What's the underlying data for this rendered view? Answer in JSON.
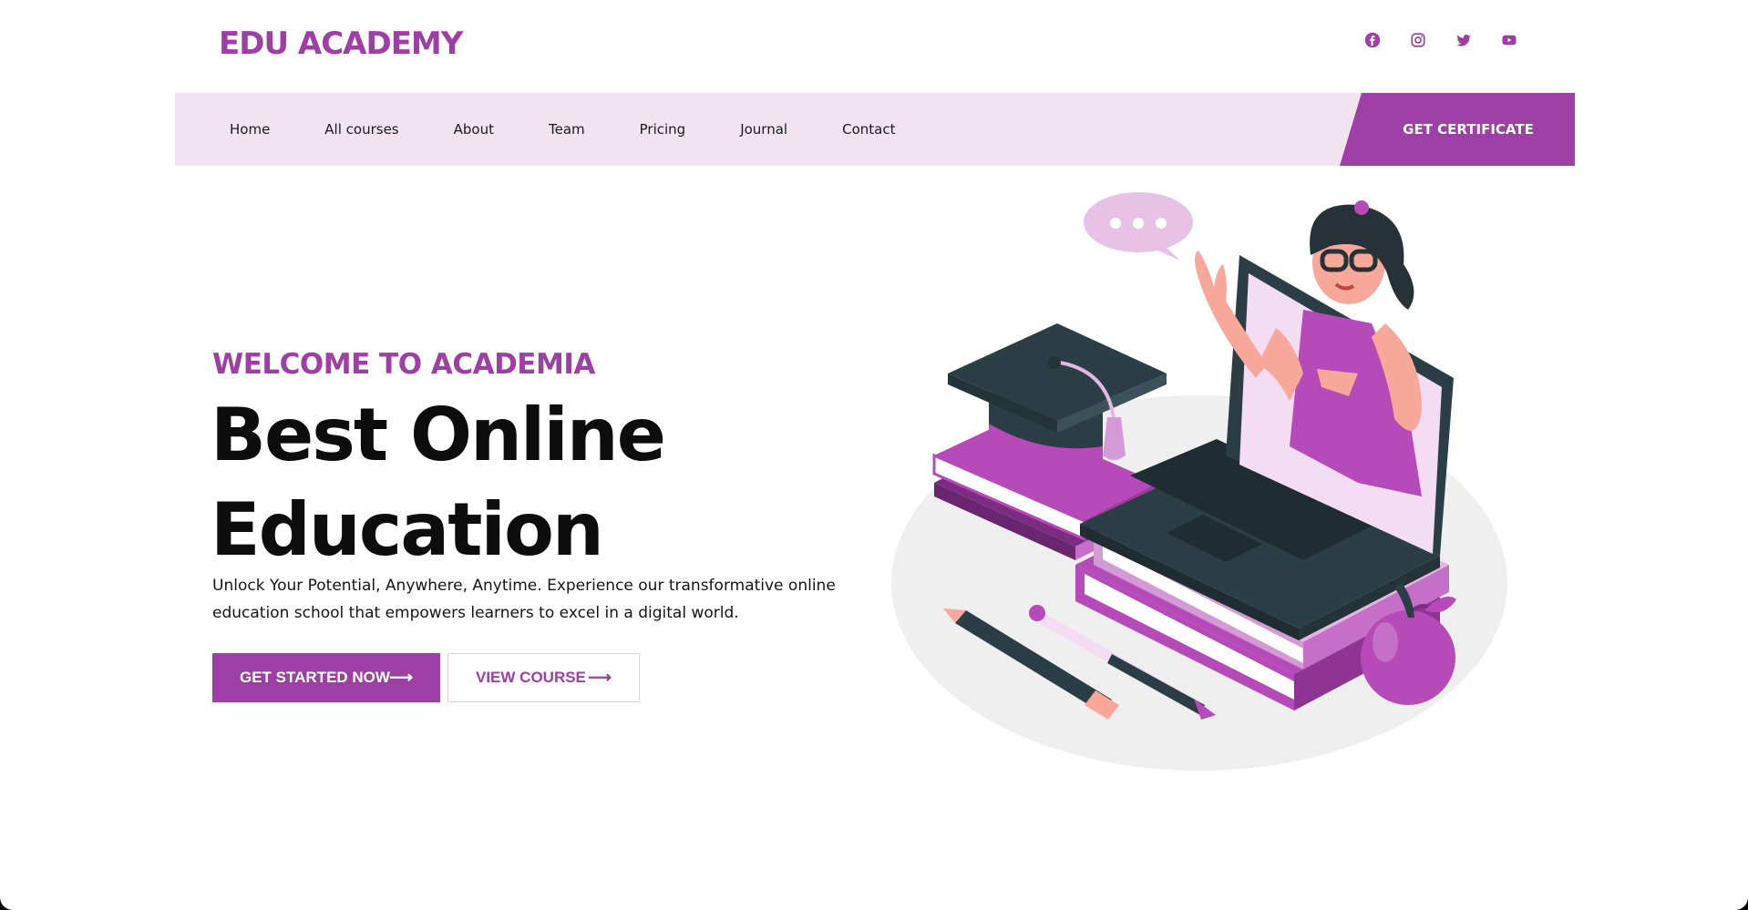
{
  "brand": {
    "name": "EDU ACADEMY"
  },
  "socials": [
    {
      "icon": "facebook-icon"
    },
    {
      "icon": "instagram-icon"
    },
    {
      "icon": "twitter-icon"
    },
    {
      "icon": "youtube-icon"
    }
  ],
  "nav": {
    "items": [
      "Home",
      "All courses",
      "About",
      "Team",
      "Pricing",
      "Journal",
      "Contact"
    ],
    "cta": "GET CERTIFICATE"
  },
  "hero": {
    "eyebrow": "WELCOME TO ACADEMIA",
    "title_line1": "Best Online",
    "title_line2": "Education",
    "subtitle": "Unlock Your Potential, Anywhere, Anytime. Experience our transformative online education school that empowers learners to excel in a digital world.",
    "primary_button": "GET STARTED NOW",
    "secondary_button": "VIEW COURSE",
    "arrow": "⟶"
  },
  "colors": {
    "accent": "#9d3fa5",
    "nav_bg": "#f1e4f0",
    "dark": "#2c3e45"
  }
}
